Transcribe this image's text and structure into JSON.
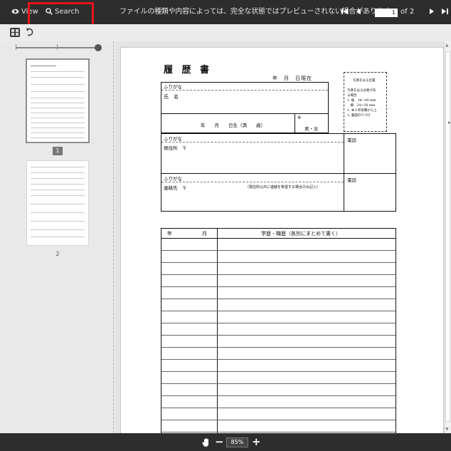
{
  "toolbar": {
    "view_label": "View",
    "search_label": "Search",
    "notice": "ファイルの種類や内容によっては、完全な状態ではプレビューされない場合があります。",
    "current_page": "1",
    "page_total": "of 2"
  },
  "sidebar": {
    "thumbnails": [
      {
        "label": "1",
        "selected": true
      },
      {
        "label": "2",
        "selected": false
      }
    ]
  },
  "zoom": {
    "value": "85%",
    "minus": "−",
    "plus": "+"
  },
  "resume": {
    "title": "履 歴 書",
    "date_line": "年　月　日現在",
    "furigana": "ふりがな",
    "name_label": "氏　名",
    "birth_line": "年　　月　　日生（満　　歳）",
    "note_mark": "※",
    "gender": "男・女",
    "furigana_address": "ふりがな",
    "address_label": "現住所　〒",
    "phone_label_1": "電話",
    "furigana_contact": "ふりがな",
    "contact_label": "連絡先　〒",
    "contact_note": "（現住所以外に連絡を希望する場合のみ記入）",
    "phone_label_2": "電話",
    "photo_text": [
      "写真をはる位置",
      "写真をはる必要があ",
      "る場合",
      "1. 縦　36〜40 mm",
      "　横　24〜30 mm",
      "2. 本人単身胸から上",
      "3. 裏面のりづけ"
    ],
    "history_header_year": "年",
    "history_header_month": "月",
    "history_header_title": "学歴・職歴（各別にまとめて書く）"
  }
}
